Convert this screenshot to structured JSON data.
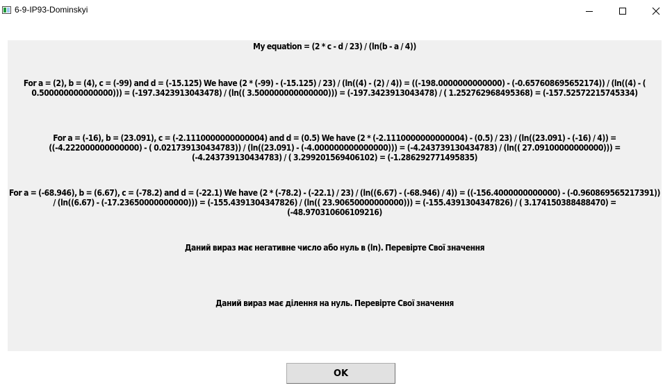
{
  "window": {
    "title": "6-9-IP93-Dominskyi"
  },
  "dialog": {
    "equation": "My equation = (2 * c - d / 23) / (ln(b - a / 4))",
    "result_1": "For a = (2), b = (4), c = (-99) and d = (-15.125) We have (2 * (-99) - (-15.125) / 23) / (ln((4) - (2) / 4)) = ((-198.0000000000000) - (-0.657608695652174)) / (ln((4) - ( 0.500000000000000))) = (-197.3423913043478) / (ln(( 3.500000000000000))) = (-197.3423913043478) / ( 1.252762968495368) = (-157.52572215745334)",
    "result_2": "For a = (-16), b = (23.091), c = (-2.1110000000000004) and d = (0.5) We have (2 * (-2.1110000000000004) - (0.5) / 23) / (ln((23.091) - (-16) / 4)) = ((-4.222000000000000) - ( 0.021739130434783)) / (ln((23.091) - (-4.000000000000000))) = (-4.243739130434783) / (ln(( 27.09100000000000))) = (-4.243739130434783) / ( 3.299201569406102) = (-1.286292771495835)",
    "result_3": "For a = (-68.946), b = (6.67), c = (-78.2) and d = (-22.1) We have (2 * (-78.2) - (-22.1) / 23) / (ln((6.67) - (-68.946) / 4)) = ((-156.4000000000000) - (-0.960869565217391)) / (ln((6.67) - (-17.23650000000000))) = (-155.4391304347826) / (ln(( 23.90650000000000))) = (-155.4391304347826) / ( 3.174150388488470) = (-48.970310606109216)",
    "error_log": "Даний вираз має негативне число або нуль в (ln). Перевірте Свої значення",
    "error_div": "Даний вираз має ділення на нуль. Перевірте Свої значення",
    "ok_label": "OK"
  }
}
